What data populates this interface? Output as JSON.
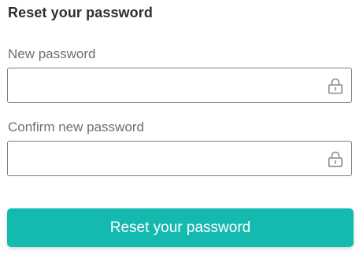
{
  "form": {
    "title": "Reset your password",
    "new_password": {
      "label": "New password",
      "value": "",
      "icon": "lock-icon"
    },
    "confirm_password": {
      "label": "Confirm new password",
      "value": "",
      "icon": "lock-icon"
    },
    "submit_label": "Reset your password"
  },
  "colors": {
    "accent": "#14bab0",
    "border": "#7c7c7c",
    "label": "#6f6f6f",
    "title": "#2f2f2f"
  }
}
